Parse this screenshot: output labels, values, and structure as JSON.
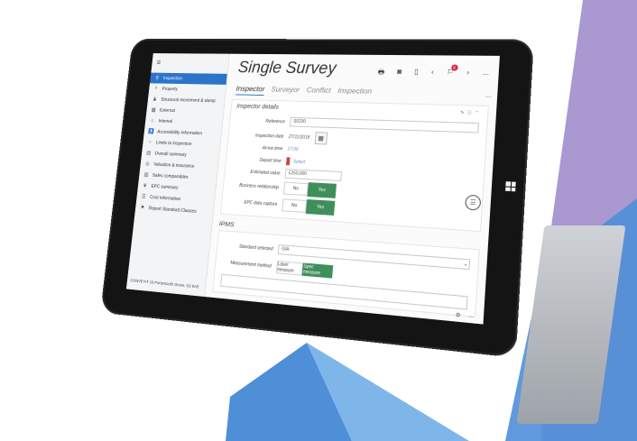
{
  "colors": {
    "accent": "#2c74c9",
    "green": "#3f8f5b",
    "purple": "#9b86c9",
    "blue": "#4f8fd8"
  },
  "app": {
    "title": "Single Survey"
  },
  "toolbar": {
    "icons": [
      "print-icon",
      "camera-icon",
      "clipboard-icon",
      "back-icon",
      "flag-icon",
      "forward-icon",
      "more-icon"
    ],
    "notification_count": "8",
    "more": "..."
  },
  "sidebar": {
    "items": [
      {
        "label": "Inspection",
        "icon": "pin-icon",
        "active": true
      },
      {
        "label": "Property",
        "icon": "search-icon"
      },
      {
        "label": "Structural movement & damp",
        "icon": "people-icon"
      },
      {
        "label": "External",
        "icon": "brick-icon"
      },
      {
        "label": "Internal",
        "icon": "home-icon"
      },
      {
        "label": "Accessibility information",
        "icon": "wheelchair-icon"
      },
      {
        "label": "Limits to inspection",
        "icon": "circle-icon"
      },
      {
        "label": "Overall summary",
        "icon": "doc-icon"
      },
      {
        "label": "Valuation & insurance",
        "icon": "coins-icon"
      },
      {
        "label": "Sales comparables",
        "icon": "chart-icon"
      },
      {
        "label": "EPC summary",
        "icon": "leaf-icon"
      },
      {
        "label": "Cost information",
        "icon": "list-icon"
      },
      {
        "label": "Report Standard Clauses",
        "icon": "clauses-icon"
      }
    ],
    "address": "CONVEYIT 15 Portsmouth Grove, S2 8AE"
  },
  "tabs": [
    "Inspector",
    "Surveyor",
    "Conflict",
    "Inspection"
  ],
  "inspector_details": {
    "title": "Inspector details",
    "reference_label": "Reference",
    "reference_value": "S0230",
    "inspection_date_label": "Inspection date",
    "inspection_date_value": "27/11/2018",
    "arrive_time_label": "Arrive time",
    "arrive_time_value": "17:00",
    "depart_time_label": "Depart time",
    "depart_time_value": "Select",
    "estimated_value_label": "Estimated value",
    "estimated_value_value": "£250,000",
    "business_relationship_label": "Business relationship",
    "epc_data_capture_label": "EPC data capture",
    "no_label": "No",
    "yes_label": "Yes"
  },
  "ipms": {
    "title": "IPMS",
    "standard_selected_label": "Standard selected",
    "standard_selected_value": "GIA",
    "measurement_method_label": "Measurement method",
    "method_manual": "Laser measure",
    "method_alt": "Spec measure"
  },
  "footer": {
    "icons": [
      "settings-icon",
      "more-icon"
    ],
    "more": "..."
  }
}
